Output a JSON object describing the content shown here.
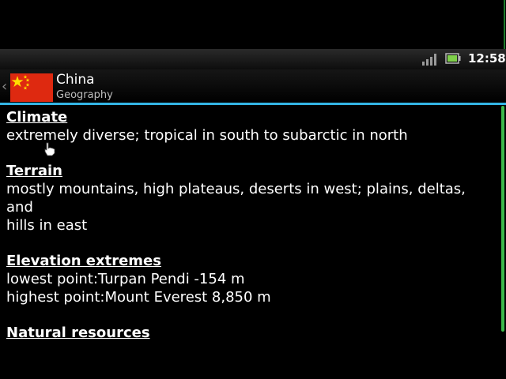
{
  "status_bar": {
    "time": "12:58",
    "icons": [
      "signal-icon",
      "battery-icon"
    ]
  },
  "title_bar": {
    "icons": [
      "back-chevron-icon",
      "china-flag-icon"
    ],
    "back_glyph": "‹",
    "title": "China",
    "subtitle": "Geography"
  },
  "sections": [
    {
      "heading": "Climate",
      "lines": [
        "extremely diverse; tropical in south to subarctic in north"
      ]
    },
    {
      "heading": "Terrain",
      "lines": [
        "mostly mountains, high plateaus, deserts in west; plains, deltas, and",
        "hills in east"
      ]
    },
    {
      "heading": "Elevation extremes",
      "lines": [
        "lowest point:Turpan Pendi -154 m",
        "highest point:Mount Everest 8,850 m"
      ]
    },
    {
      "heading": "Natural resources",
      "lines": []
    }
  ],
  "colors": {
    "accent": "#33b5e5",
    "scrollbar": "#3cb84a",
    "flag_red": "#de2910",
    "flag_yellow": "#ffde00"
  }
}
